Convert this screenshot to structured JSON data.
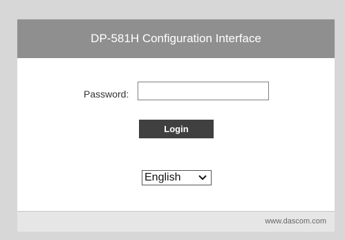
{
  "header": {
    "title": "DP-581H Configuration Interface"
  },
  "login_form": {
    "password_label": "Password:",
    "password_value": "",
    "login_button_label": "Login"
  },
  "language": {
    "selected": "English",
    "dropdown_icon": "chevron-down-icon"
  },
  "footer": {
    "website": "www.dascom.com"
  },
  "colors": {
    "page_background": "#d7d7d7",
    "header_background": "#8f8f8f",
    "button_background": "#404040",
    "footer_background": "#e6e6e6"
  }
}
